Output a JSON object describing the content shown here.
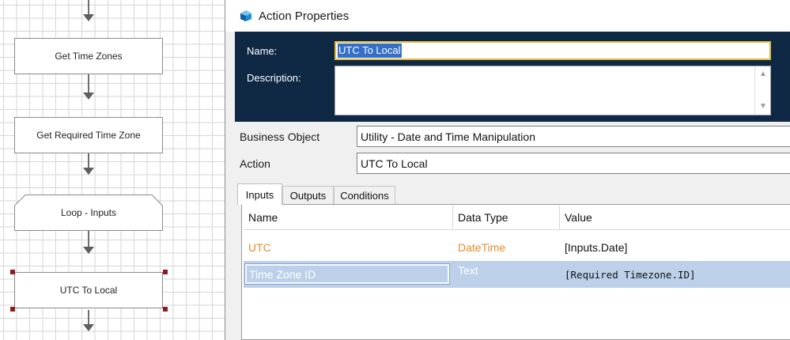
{
  "canvas": {
    "stages": [
      {
        "label": "Get Time Zones"
      },
      {
        "label": "Get Required Time Zone"
      },
      {
        "label": "Loop - Inputs"
      },
      {
        "label": "UTC To Local"
      }
    ]
  },
  "dialog": {
    "title": "Action Properties",
    "icon": "blue-prism-logo-icon",
    "name_label": "Name:",
    "name_value": "UTC To Local",
    "description_label": "Description:",
    "description_value": "",
    "business_object_label": "Business Object",
    "business_object_value": "Utility - Date and Time Manipulation",
    "action_label": "Action",
    "action_value": "UTC To Local",
    "tabs": [
      {
        "label": "Inputs",
        "active": true
      },
      {
        "label": "Outputs",
        "active": false
      },
      {
        "label": "Conditions",
        "active": false
      }
    ],
    "grid": {
      "columns": [
        "Name",
        "Data Type",
        "Value"
      ],
      "rows": [
        {
          "name": "UTC",
          "type": "DateTime",
          "value": "[Inputs.Date]"
        },
        {
          "name": "Time Zone ID",
          "type": "Text",
          "value": "[Required Timezone.ID]"
        }
      ]
    },
    "colors": {
      "header_bg": "#0f2844",
      "highlight": "#e88a2b",
      "selection": "#bcd0ea"
    }
  }
}
